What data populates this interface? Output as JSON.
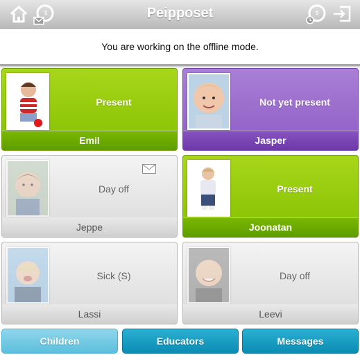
{
  "header": {
    "title": "Peipposet",
    "home_icon": "home-icon",
    "messages_icon": "mail-icon",
    "messages_count": "1",
    "activity_count": "5",
    "logout_icon": "logout-icon"
  },
  "notice": "You are working on the offline mode.",
  "children": [
    {
      "name": "Emil",
      "status": "Present",
      "state": "present",
      "has_message": false
    },
    {
      "name": "Jasper",
      "status": "Not yet present",
      "state": "notyet",
      "has_message": false
    },
    {
      "name": "Jeppe",
      "status": "Day off",
      "state": "absent",
      "has_message": true
    },
    {
      "name": "Joonatan",
      "status": "Present",
      "state": "present",
      "has_message": false
    },
    {
      "name": "Lassi",
      "status": "Sick (S)",
      "state": "absent",
      "has_message": false
    },
    {
      "name": "Leevi",
      "status": "Day off",
      "state": "absent",
      "has_message": false
    }
  ],
  "tabs": [
    {
      "label": "Children",
      "active": true
    },
    {
      "label": "Educators",
      "active": false
    },
    {
      "label": "Messages",
      "active": false
    }
  ],
  "colors": {
    "present": "#84c000",
    "not_yet_present": "#8d5cc4",
    "absent": "#d9d9d9",
    "tab_active": "#5cbfdc",
    "tab_inactive": "#0a8bb3"
  }
}
